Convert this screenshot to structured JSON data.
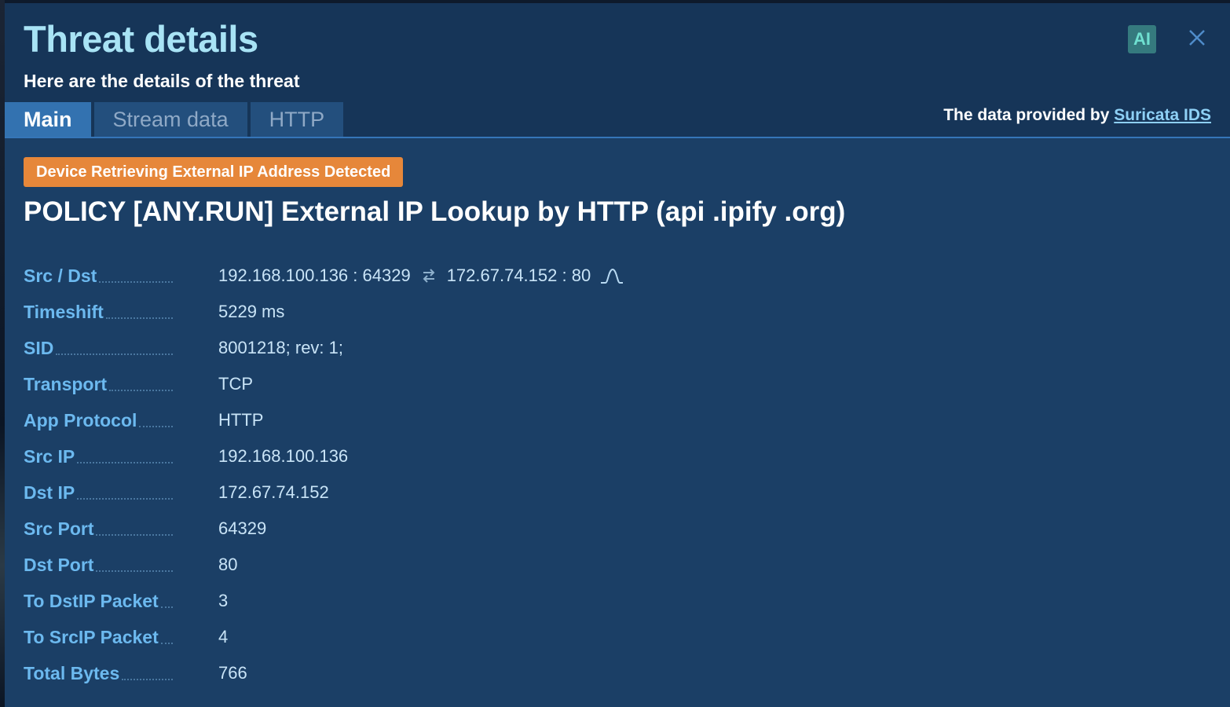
{
  "header": {
    "title": "Threat details",
    "subtitle": "Here are the details of the threat",
    "ai_button_label": "AI",
    "close_icon": "close-icon"
  },
  "tabs": [
    {
      "label": "Main",
      "active": true
    },
    {
      "label": "Stream data",
      "active": false
    },
    {
      "label": "HTTP",
      "active": false
    }
  ],
  "provider": {
    "prefix": "The data provided by ",
    "link_label": "Suricata IDS"
  },
  "threat": {
    "category_badge": "Device Retrieving External IP Address Detected",
    "rule_name": "POLICY [ANY.RUN] External IP Lookup by HTTP (api .ipify .org)",
    "badge_color": "#e6873a"
  },
  "src_dst": {
    "label": "Src / Dst",
    "src": "192.168.100.136 : 64329",
    "swap_icon": "swap-arrows-icon",
    "dst": "172.67.74.152 : 80",
    "wave_icon": "signal-wave-icon"
  },
  "details": [
    {
      "label": "Timeshift",
      "value": "5229 ms"
    },
    {
      "label": "SID",
      "value": "8001218; rev: 1;"
    },
    {
      "label": "Transport",
      "value": "TCP"
    },
    {
      "label": "App Protocol",
      "value": "HTTP"
    },
    {
      "label": "Src IP",
      "value": "192.168.100.136"
    },
    {
      "label": "Dst IP",
      "value": "172.67.74.152"
    },
    {
      "label": "Src Port",
      "value": "64329"
    },
    {
      "label": "Dst Port",
      "value": "80"
    },
    {
      "label": "To DstIP Packet",
      "value": "3"
    },
    {
      "label": "To SrcIP Packet",
      "value": "4"
    },
    {
      "label": "Total Bytes",
      "value": "766"
    }
  ]
}
